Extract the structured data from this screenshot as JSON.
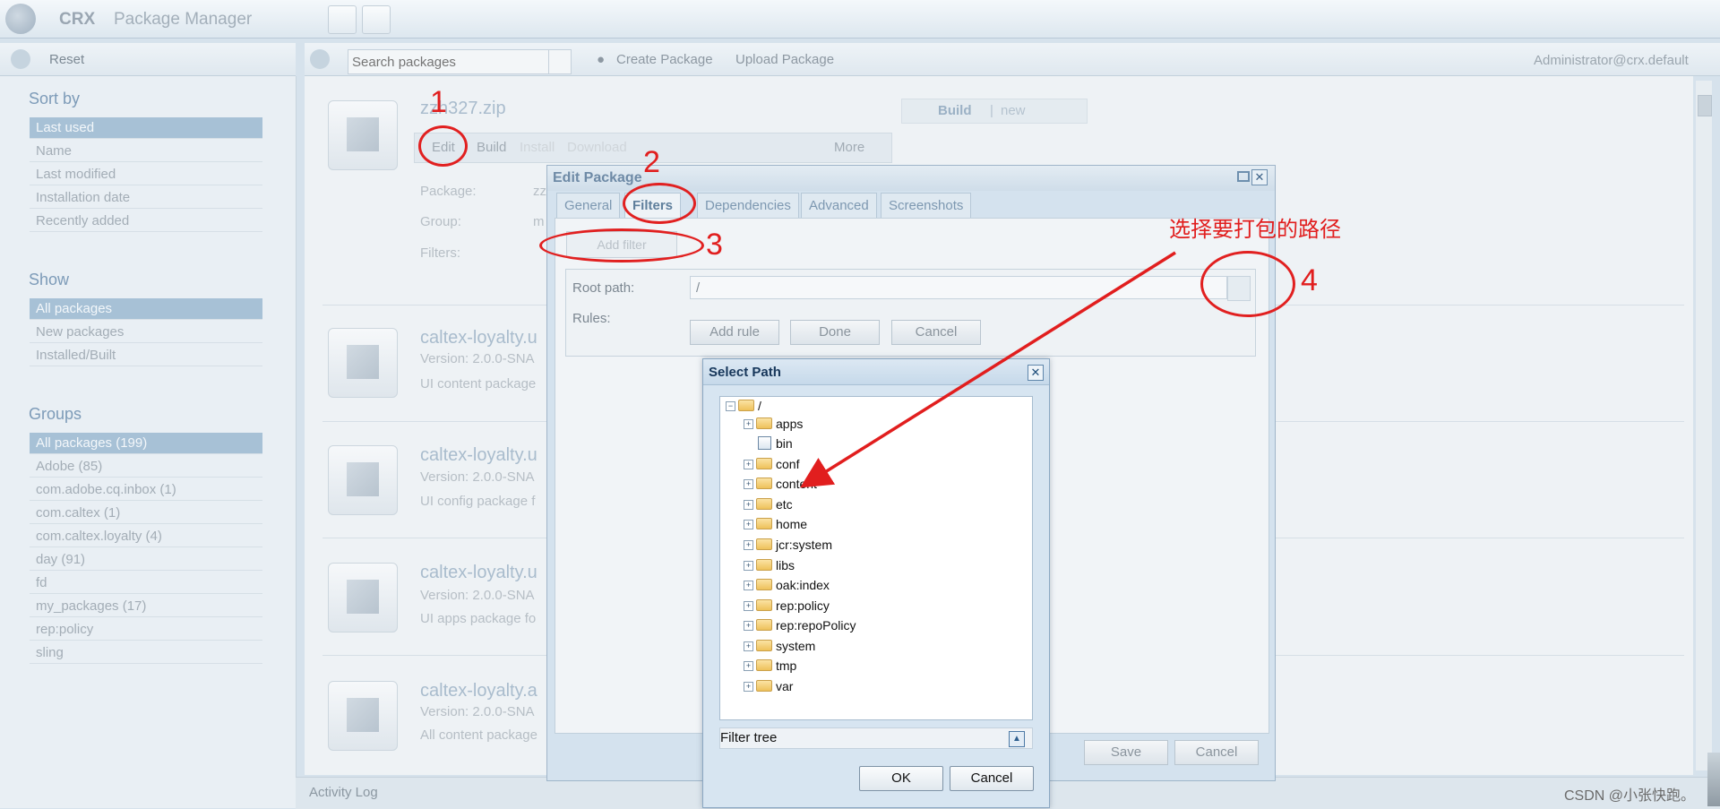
{
  "app": {
    "brand": "CRX",
    "title": "Package Manager"
  },
  "left_toolbar": {
    "reset_label": "Reset"
  },
  "sidebar": {
    "sort_title": "Sort by",
    "sort_items": [
      "Last used",
      "Name",
      "Last modified",
      "Installation date",
      "Recently added"
    ],
    "show_title": "Show",
    "show_items": [
      "All packages",
      "New packages",
      "Installed/Built"
    ],
    "groups_title": "Groups",
    "groups": [
      "All packages (199)",
      "Adobe (85)",
      "com.adobe.cq.inbox (1)",
      "com.caltex (1)",
      "com.caltex.loyalty (4)",
      "day (91)",
      "fd",
      "my_packages (17)",
      "rep:policy",
      "sling"
    ]
  },
  "main_toolbar": {
    "search_placeholder": "Search packages",
    "create_label": "Create Package",
    "upload_label": "Upload Package",
    "user": "Administrator@crx.default"
  },
  "selected_package": {
    "name": "zzh327.zip",
    "actions": {
      "edit": "Edit",
      "build": "Build",
      "install": "Install",
      "download": "Download",
      "more": "More"
    },
    "build_status": {
      "build": "Build",
      "sep": "|",
      "state": "new"
    },
    "fields": {
      "package_label": "Package:",
      "package_value": "zz",
      "group_label": "Group:",
      "group_value": "m",
      "filters_label": "Filters:"
    }
  },
  "packages": [
    {
      "name": "caltex-loyalty.u",
      "version": "Version: 2.0.0-SNA",
      "desc": "UI content package"
    },
    {
      "name": "caltex-loyalty.u",
      "version": "Version: 2.0.0-SNA",
      "desc": "UI config package f"
    },
    {
      "name": "caltex-loyalty.u",
      "version": "Version: 2.0.0-SNA",
      "desc": "UI apps package fo"
    },
    {
      "name": "caltex-loyalty.a",
      "version": "Version: 2.0.0-SNA",
      "desc": "All content package"
    }
  ],
  "edit_dialog": {
    "title": "Edit Package",
    "tabs": [
      "General",
      "Filters",
      "Dependencies",
      "Advanced",
      "Screenshots"
    ],
    "active_tab": "Filters",
    "add_filter": "Add filter",
    "root_path_label": "Root path:",
    "root_path_value": "/",
    "rules_label": "Rules:",
    "add_rule": "Add rule",
    "done": "Done",
    "cancel": "Cancel",
    "save": "Save",
    "footer_cancel": "Cancel"
  },
  "select_path": {
    "title": "Select Path",
    "root": "/",
    "nodes": [
      "apps",
      "bin",
      "conf",
      "content",
      "etc",
      "home",
      "jcr:system",
      "libs",
      "oak:index",
      "rep:policy",
      "rep:repoPolicy",
      "system",
      "tmp",
      "var"
    ],
    "filter_label": "Filter tree",
    "ok": "OK",
    "cancel": "Cancel"
  },
  "activity_log": "Activity Log",
  "annotations": {
    "n1": "1",
    "n2": "2",
    "n3": "3",
    "n4": "4",
    "note": "选择要打包的路径",
    "color": "#e11e1e"
  },
  "watermark": "CSDN @小张快跑。"
}
